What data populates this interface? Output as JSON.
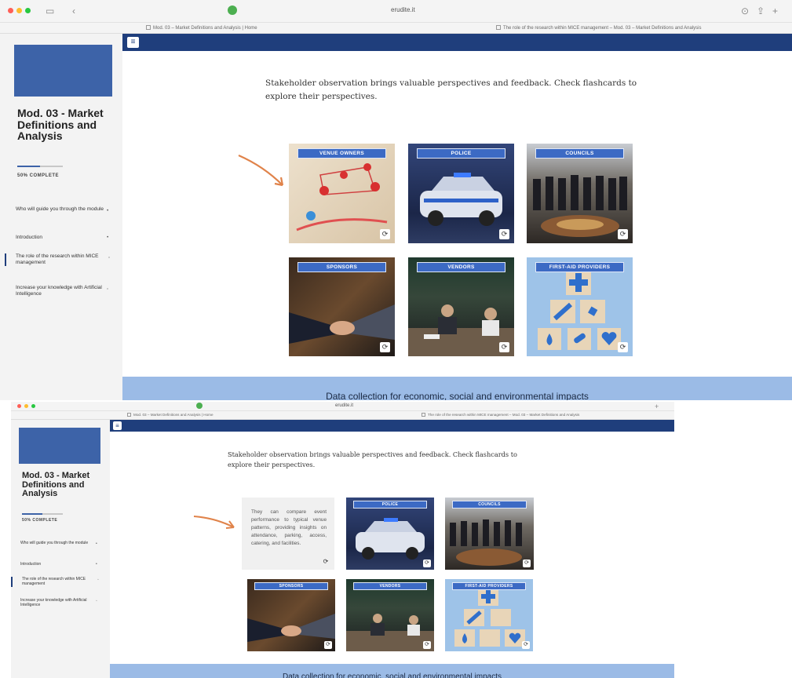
{
  "browser": {
    "url": "erudite.it",
    "tabs": [
      "Mod. 03 – Market Definitions and Analysis | Home",
      "The role of the research within MICE management – Mod. 03 – Market Definitions and Analysis"
    ]
  },
  "sidebar": {
    "course_title": "Mod. 03 - Market Definitions and Analysis",
    "progress_text": "50% COMPLETE",
    "progress_percent": 50,
    "items": [
      {
        "label": "Who will guide you through the module"
      },
      {
        "label": "Introduction"
      },
      {
        "label": "The role of the research within MICE management",
        "active": true
      },
      {
        "label": "Increase your knowledge with Artificial Intelligence"
      }
    ]
  },
  "main": {
    "intro_text": "Stakeholder observation brings valuable perspectives and feedback. Check flashcards to explore their perspectives.",
    "cards": [
      {
        "label": "VENUE OWNERS"
      },
      {
        "label": "POLICE"
      },
      {
        "label": "COUNCILS"
      },
      {
        "label": "SPONSORS"
      },
      {
        "label": "VENDORS"
      },
      {
        "label": "FIRST-AID PROVIDERS"
      }
    ],
    "flipped_card_text": "They can compare event performance to typical venue patterns, providing insights on attendance, parking, access, catering, and facilities.",
    "section_title": "Data collection for economic, social and environmental impacts"
  },
  "icons": {
    "flip": "flip-icon",
    "menu": "hamburger-menu-icon",
    "arrow": "annotation-arrow-icon"
  },
  "colors": {
    "header_bar": "#1f3e7c",
    "logo_block": "#3d63a8",
    "card_label": "#3c6ac4",
    "section_bar": "#9bbbe6",
    "arrow": "#e0834a"
  }
}
